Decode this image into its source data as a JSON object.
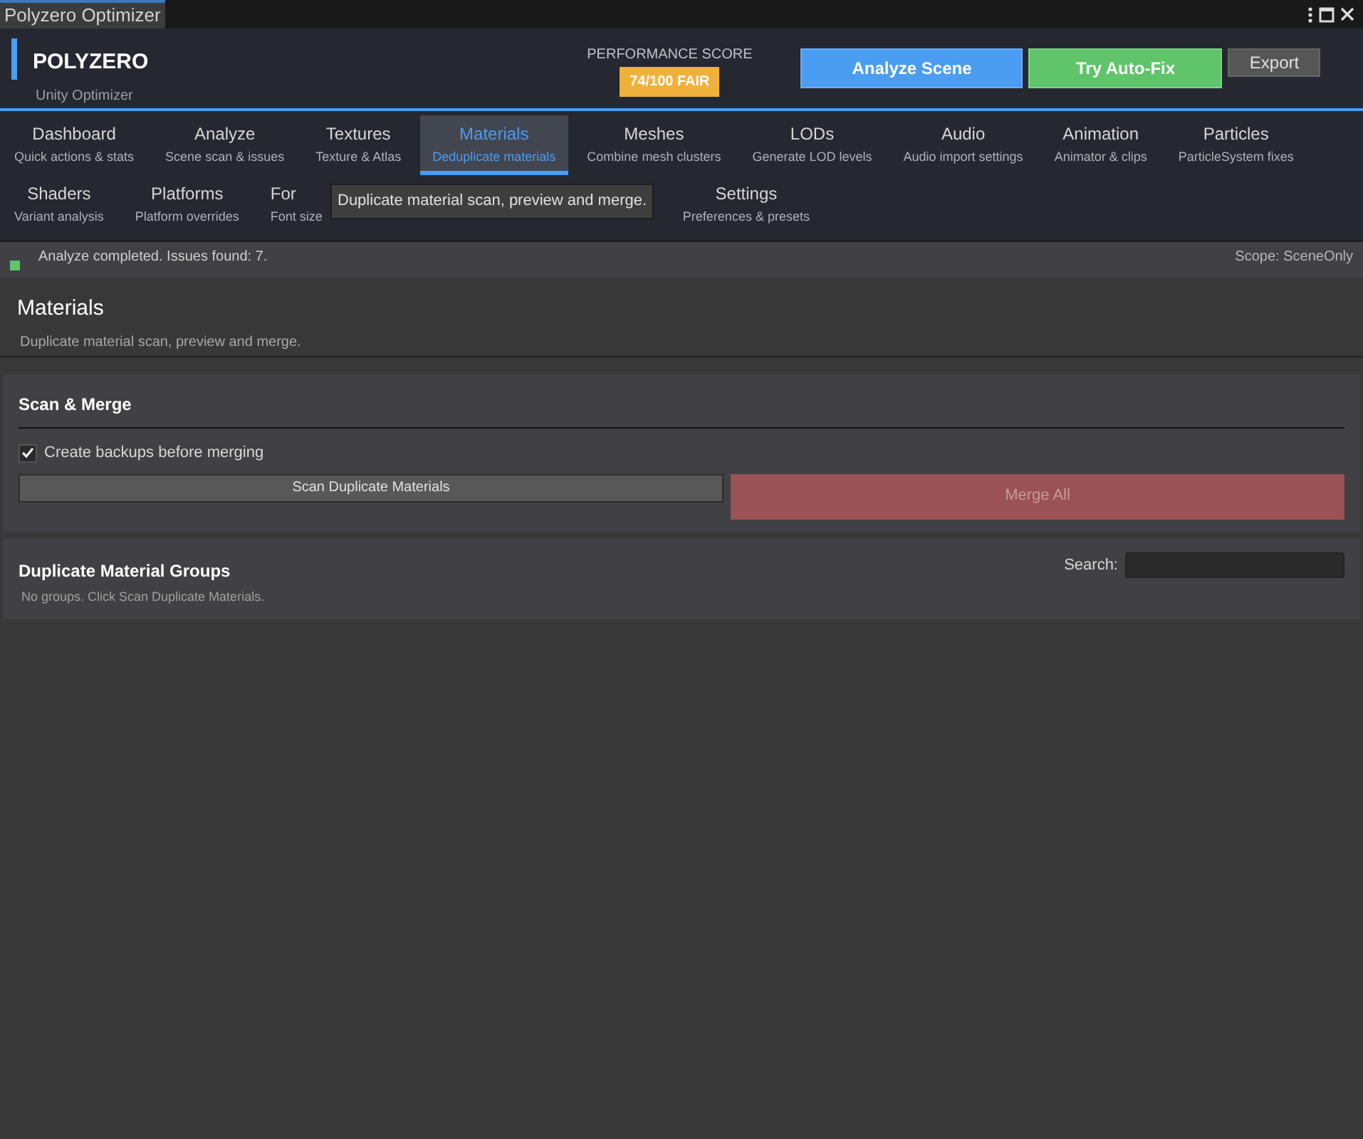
{
  "window": {
    "title": "Polyzero Optimizer"
  },
  "header": {
    "brand": "POLYZERO",
    "subtitle": "Unity Optimizer",
    "score_label": "PERFORMANCE SCORE",
    "score": "74/100 FAIR",
    "buttons": [
      {
        "label": "Analyze Scene",
        "kind": "primary"
      },
      {
        "label": "Try Auto-Fix",
        "kind": "success"
      },
      {
        "label": "Export",
        "kind": "plain"
      }
    ]
  },
  "tab_rows": [
    {
      "tabs": [
        {
          "label": "Dashboard",
          "caption": "Quick actions & stats",
          "selected": false
        },
        {
          "label": "Analyze",
          "caption": "Scene scan & issues",
          "selected": false
        },
        {
          "label": "Textures",
          "caption": "Texture & Atlas",
          "selected": false
        },
        {
          "label": "Materials",
          "caption": "Deduplicate materials",
          "selected": true
        },
        {
          "label": "Meshes",
          "caption": "Combine mesh clusters",
          "selected": false
        },
        {
          "label": "LODs",
          "caption": "Generate LOD levels",
          "selected": false
        },
        {
          "label": "Audio",
          "caption": "Audio import settings",
          "selected": false
        },
        {
          "label": "Animation",
          "caption": "Animator & clips",
          "selected": false
        },
        {
          "label": "Particles",
          "caption": "ParticleSystem fixes",
          "selected": false
        }
      ]
    },
    {
      "tabs": [
        {
          "label": "Shaders",
          "caption": "Variant analysis",
          "selected": false
        },
        {
          "label": "Platforms",
          "caption": "Platform overrides",
          "selected": false
        },
        {
          "label": "For",
          "caption": "Font size",
          "selected": false,
          "kind": "covered"
        },
        {
          "label": "Settings",
          "caption": "Preferences & presets",
          "selected": false
        }
      ]
    }
  ],
  "tooltip": "Duplicate material scan, preview and merge.",
  "status_bar": {
    "message": "Analyze completed. Issues found: 7.",
    "scope": "Scope: SceneOnly",
    "color": "#5fc46a"
  },
  "page": {
    "title": "Materials",
    "description": "Duplicate material scan, preview and merge."
  },
  "scan_merge": {
    "title": "Scan & Merge",
    "backup": {
      "label": "Create backups before merging",
      "checked": true
    },
    "scan_button": "Scan Duplicate Materials",
    "merge_button": {
      "label": "Merge All",
      "disabled": true
    }
  },
  "groups": {
    "title": "Duplicate Material Groups",
    "search_label": "Search:",
    "empty": "No groups. Click Scan Duplicate Materials."
  }
}
